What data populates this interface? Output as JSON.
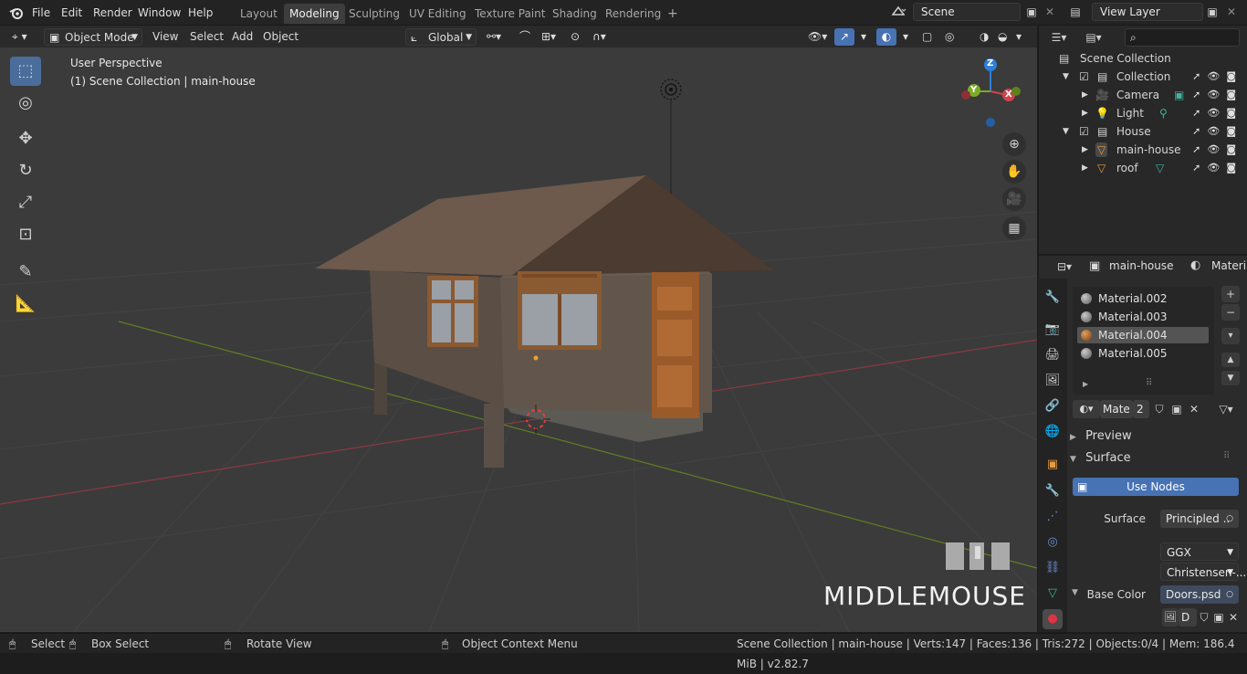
{
  "topbar": {
    "menus": [
      "File",
      "Edit",
      "Render",
      "Window",
      "Help"
    ],
    "workspaces": [
      "Layout",
      "Modeling",
      "Sculpting",
      "UV Editing",
      "Texture Paint",
      "Shading",
      "Rendering"
    ],
    "active_workspace": "Modeling",
    "add_workspace": "+",
    "scene_name": "Scene",
    "view_layer_name": "View Layer"
  },
  "viewport_header": {
    "mode": "Object Mode",
    "menus": [
      "View",
      "Select",
      "Add",
      "Object"
    ],
    "orientation": "Global"
  },
  "viewport": {
    "view_name": "User Perspective",
    "collection_info": "(1) Scene Collection | main-house",
    "gizmo_axes": {
      "z": "Z",
      "y": "Y",
      "x": "X"
    }
  },
  "outliner": {
    "root": "Scene Collection",
    "items": [
      {
        "label": "Collection",
        "type": "collection"
      },
      {
        "label": "Camera",
        "type": "camera"
      },
      {
        "label": "Light",
        "type": "light"
      },
      {
        "label": "House",
        "type": "collection"
      },
      {
        "label": "main-house",
        "type": "mesh"
      },
      {
        "label": "roof",
        "type": "mesh"
      }
    ]
  },
  "properties": {
    "object_name": "main-house",
    "tab_label": "Materia",
    "material_slots": [
      "Material.002",
      "Material.003",
      "Material.004",
      "Material.005"
    ],
    "selected_slot": "Material.004",
    "material_field": "Mate",
    "user_count": "2",
    "preview_label": "Preview",
    "surface_label": "Surface",
    "use_nodes_label": "Use Nodes",
    "surface_field_label": "Surface",
    "surface_value": "Principled ..",
    "distribution": "GGX",
    "subsurface_method": "Christensen-...",
    "base_color_label": "Base Color",
    "base_color_value": "Doors.psd",
    "image_field": "D"
  },
  "watermark": {
    "text": "MIDDLEMOUSE"
  },
  "statusbar": {
    "select": "Select",
    "box_select": "Box Select",
    "rotate_view": "Rotate View",
    "context_menu": "Object Context Menu",
    "stats": "Scene Collection | main-house | Verts:147 | Faces:136 | Tris:272 | Objects:0/4 | Mem: 186.4 MiB | v2.82.7"
  },
  "colors": {
    "accent_blue": "#4772b3",
    "axis_x": "#d1434b",
    "axis_y": "#7bac25",
    "axis_z": "#2f7ed7",
    "selected_tool": "#4b6d9b"
  }
}
